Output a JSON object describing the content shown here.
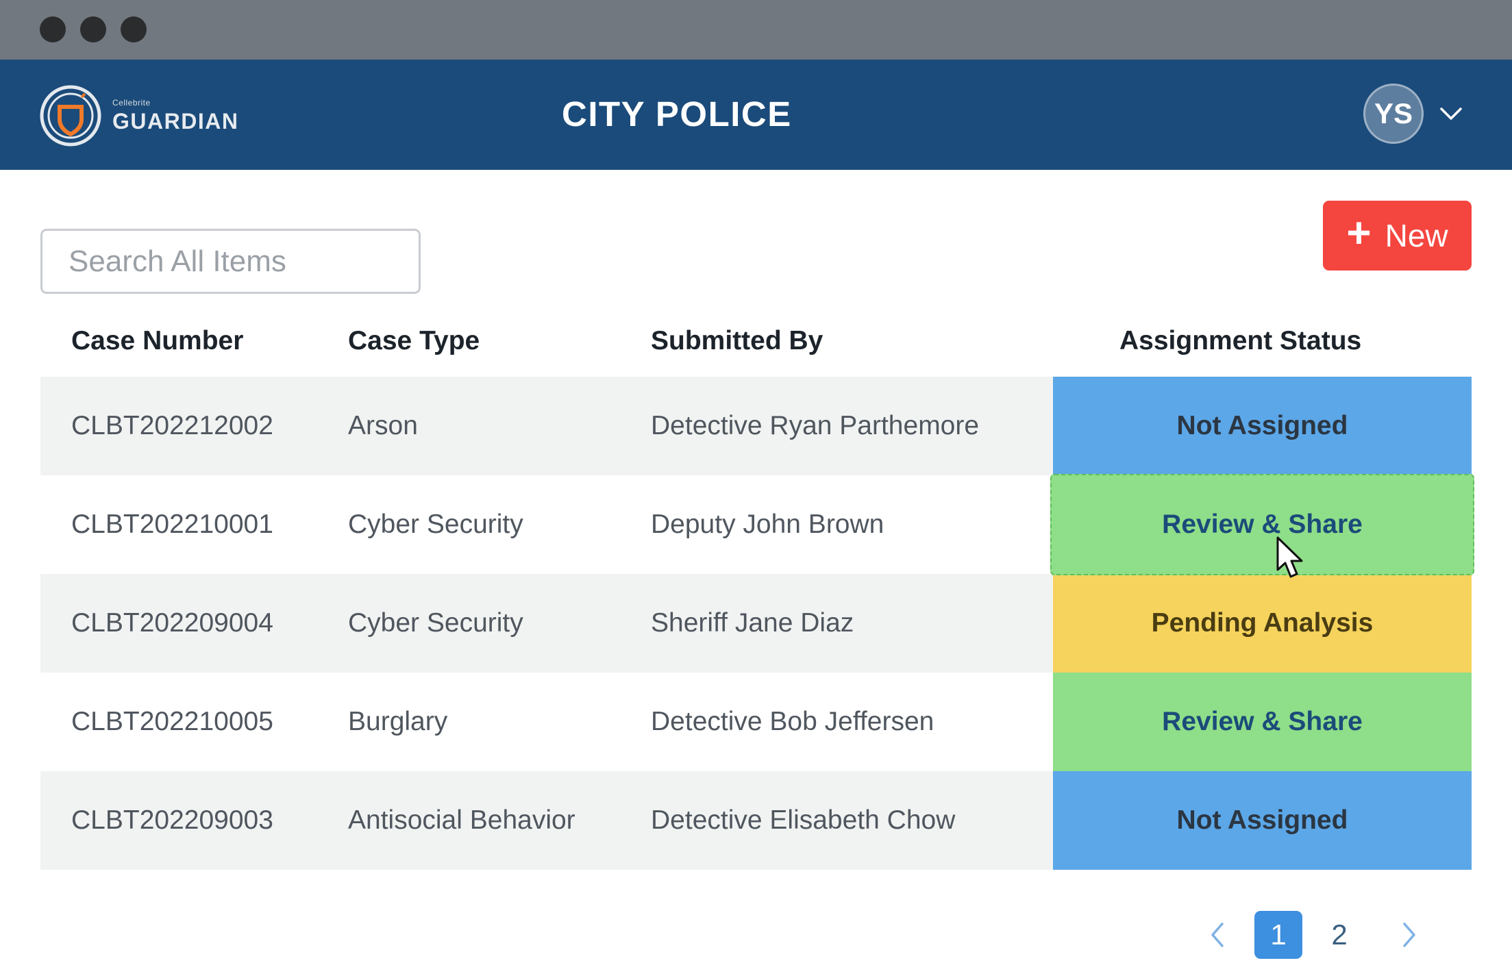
{
  "header": {
    "logo_small": "Cellebrite",
    "logo_big": "GUARDIAN",
    "title": "CITY POLICE",
    "user_initials": "YS"
  },
  "toolbar": {
    "search_placeholder": "Search All Items",
    "new_button_label": "New",
    "new_button_color": "#f4463f"
  },
  "table": {
    "columns": [
      "Case Number",
      "Case Type",
      "Submitted By",
      "Assignment Status"
    ],
    "rows": [
      {
        "case_number": "CLBT202212002",
        "case_type": "Arson",
        "submitted_by": "Detective Ryan Parthemore",
        "status": "Not Assigned",
        "status_color": "#5ca7e8"
      },
      {
        "case_number": "CLBT202210001",
        "case_type": "Cyber Security",
        "submitted_by": "Deputy John Brown",
        "status": "Review & Share",
        "status_color": "#8fde89"
      },
      {
        "case_number": "CLBT202209004",
        "case_type": "Cyber Security",
        "submitted_by": "Sheriff Jane Diaz",
        "status": "Pending Analysis",
        "status_color": "#f5d35c"
      },
      {
        "case_number": "CLBT202210005",
        "case_type": "Burglary",
        "submitted_by": "Detective Bob Jeffersen",
        "status": "Review & Share",
        "status_color": "#8fde89"
      },
      {
        "case_number": "CLBT202209003",
        "case_type": "Antisocial Behavior",
        "submitted_by": "Detective Elisabeth Chow",
        "status": "Not Assigned",
        "status_color": "#5ca7e8"
      }
    ]
  },
  "pagination": {
    "pages": [
      "1",
      "2"
    ],
    "current_page": "1"
  },
  "colors": {
    "titlebar": "#72787f",
    "header": "#1b4b7a",
    "accent_blue": "#3d8fdf"
  }
}
